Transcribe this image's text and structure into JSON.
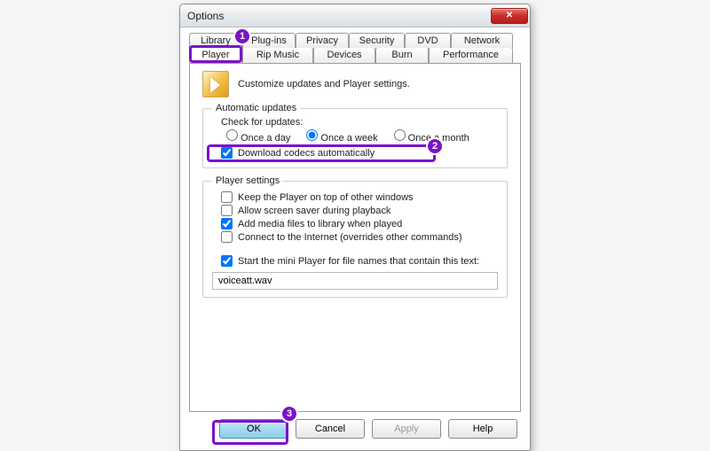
{
  "window": {
    "title": "Options"
  },
  "tabs_top": [
    {
      "label": "Library"
    },
    {
      "label": "Plug-ins"
    },
    {
      "label": "Privacy"
    },
    {
      "label": "Security"
    },
    {
      "label": "DVD"
    },
    {
      "label": "Network"
    }
  ],
  "tabs_bot": [
    {
      "label": "Player"
    },
    {
      "label": "Rip Music"
    },
    {
      "label": "Devices"
    },
    {
      "label": "Burn"
    },
    {
      "label": "Performance"
    }
  ],
  "intro": "Customize updates and Player settings.",
  "updates": {
    "legend": "Automatic updates",
    "check_label": "Check for updates:",
    "opts": [
      "Once a day",
      "Once a week",
      "Once a month"
    ],
    "selected": 1,
    "download_codecs": {
      "label": "Download codecs automatically",
      "checked": true
    }
  },
  "player": {
    "legend": "Player settings",
    "opts": [
      {
        "label": "Keep the Player on top of other windows",
        "checked": false
      },
      {
        "label": "Allow screen saver during playback",
        "checked": false
      },
      {
        "label": "Add media files to library when played",
        "checked": true
      },
      {
        "label": "Connect to the Internet (overrides other commands)",
        "checked": false
      }
    ],
    "mini": {
      "label": "Start the mini Player for file names that contain this text:",
      "checked": true
    },
    "mini_value": "voiceatt.wav"
  },
  "buttons": {
    "ok": "OK",
    "cancel": "Cancel",
    "apply": "Apply",
    "help": "Help"
  },
  "callouts": {
    "1": "1",
    "2": "2",
    "3": "3"
  }
}
